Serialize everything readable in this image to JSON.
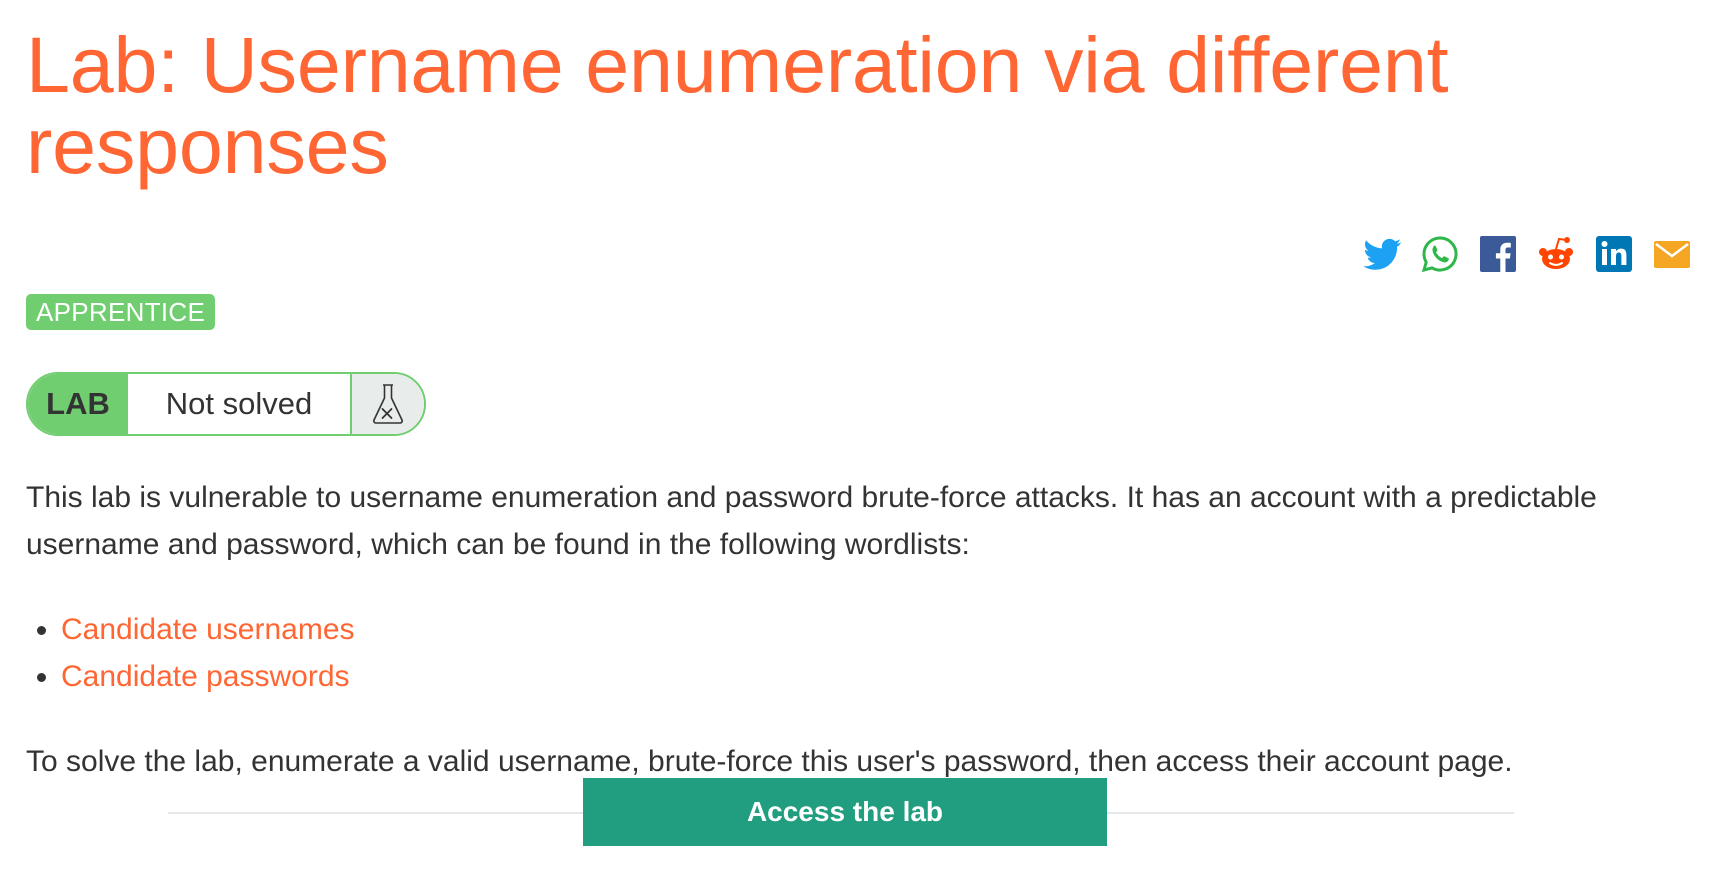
{
  "title": "Lab: Username enumeration via different responses",
  "share": {
    "icons": [
      "twitter-icon",
      "whatsapp-icon",
      "facebook-icon",
      "reddit-icon",
      "linkedin-icon",
      "email-icon"
    ],
    "colors": {
      "twitter": "#1da1f2",
      "whatsapp": "#2fb84a",
      "facebook": "#3b5a98",
      "reddit": "#ff4500",
      "linkedin": "#0077b5",
      "email": "#f5a623"
    }
  },
  "level_badge": "APPRENTICE",
  "lab_status": {
    "label": "LAB",
    "state": "Not solved",
    "icon": "flask-icon"
  },
  "description": "This lab is vulnerable to username enumeration and password brute-force attacks. It has an account with a predictable username and password, which can be found in the following wordlists:",
  "wordlists": [
    {
      "label": "Candidate usernames"
    },
    {
      "label": "Candidate passwords"
    }
  ],
  "goal": "To solve the lab, enumerate a valid username, brute-force this user's password, then access their account page.",
  "access_button": "Access the lab",
  "colors": {
    "accent": "#ff6633",
    "badge_green": "#70ce70",
    "button_teal": "#219e7f",
    "text": "#333333"
  }
}
